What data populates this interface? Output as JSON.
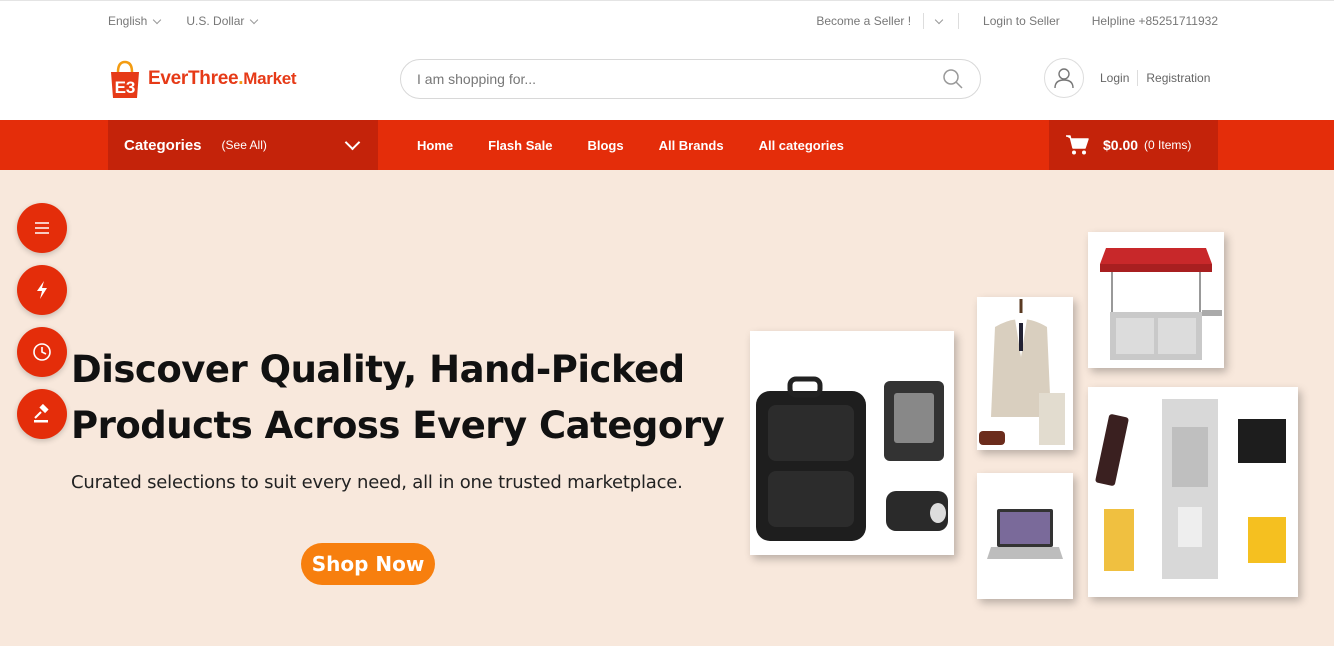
{
  "topbar": {
    "language": "English",
    "currency": "U.S. Dollar",
    "become_seller": "Become a Seller !",
    "login_seller": "Login to Seller",
    "helpline": "Helpline +85251711932"
  },
  "header": {
    "logo_main": "EverThree",
    "logo_dot": ".",
    "logo_market": "Market",
    "search_placeholder": "I am shopping for...",
    "login": "Login",
    "registration": "Registration"
  },
  "nav": {
    "categories_title": "Categories",
    "categories_see_all": "(See All)",
    "menu": [
      {
        "label": "Home"
      },
      {
        "label": "Flash Sale"
      },
      {
        "label": "Blogs"
      },
      {
        "label": "All Brands"
      },
      {
        "label": "All categories"
      }
    ],
    "cart_amount": "$0.00",
    "cart_items": "(0 Items)"
  },
  "hero": {
    "headline_line1": "Discover Quality, Hand-Picked",
    "headline_line2": "Products Across Every Category",
    "subtext": "Curated selections to suit every need, all in one trusted marketplace.",
    "cta": "Shop Now"
  },
  "floating_buttons": [
    {
      "icon": "menu-icon"
    },
    {
      "icon": "flash-icon"
    },
    {
      "icon": "clock-icon"
    },
    {
      "icon": "auction-icon"
    }
  ],
  "colors": {
    "brand_red": "#e42d0a",
    "brand_dark_red": "#c4230a",
    "cta_orange": "#f77f0e",
    "hero_bg": "#f8e8dc"
  }
}
